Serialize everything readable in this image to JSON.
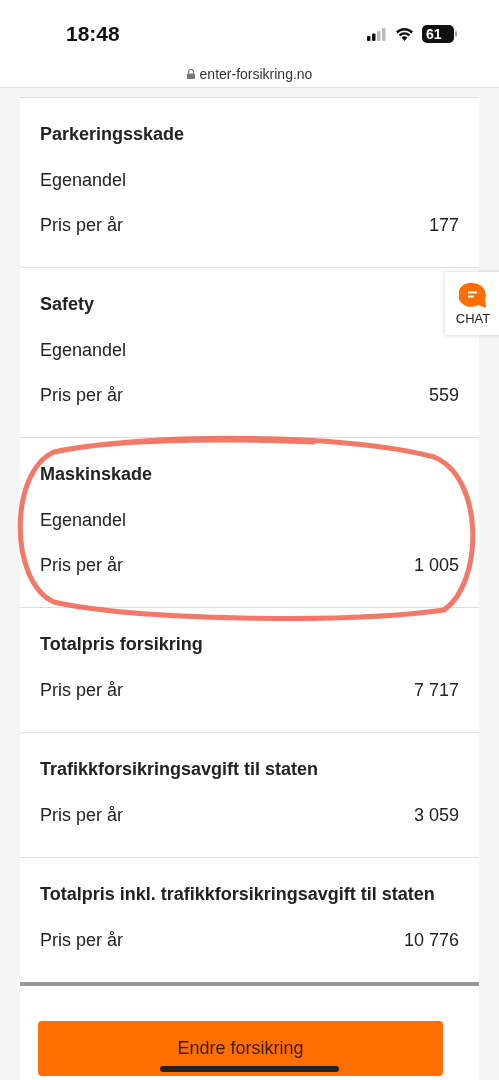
{
  "status_bar": {
    "time": "18:48",
    "battery": "61"
  },
  "address_bar": {
    "url": "enter-forsikring.no"
  },
  "sections": [
    {
      "title": "Parkeringsskade",
      "highlighted": false,
      "rows": [
        {
          "label": "Egenandel"
        },
        {
          "label": "Pris per år",
          "value": "177"
        }
      ]
    },
    {
      "title": "Safety",
      "highlighted": false,
      "rows": [
        {
          "label": "Egenandel"
        },
        {
          "label": "Pris per år",
          "value": "559"
        }
      ]
    },
    {
      "title": "Maskinskade",
      "highlighted": true,
      "rows": [
        {
          "label": "Egenandel"
        },
        {
          "label": "Pris per år",
          "value": "1 005"
        }
      ]
    },
    {
      "title": "Totalpris forsikring",
      "highlighted": false,
      "rows": [
        {
          "label": "Pris per år",
          "value": "7 717"
        }
      ]
    },
    {
      "title": "Trafikkforsikringsavgift til staten",
      "highlighted": false,
      "rows": [
        {
          "label": "Pris per år",
          "value": "3 059"
        }
      ]
    },
    {
      "title": "Totalpris inkl. trafikkforsikringsavgift til staten",
      "highlighted": false,
      "rows": [
        {
          "label": "Pris per år",
          "value": "10 776"
        }
      ]
    }
  ],
  "chat": {
    "label": "CHAT"
  },
  "button": {
    "label": "Endre forsikring"
  }
}
